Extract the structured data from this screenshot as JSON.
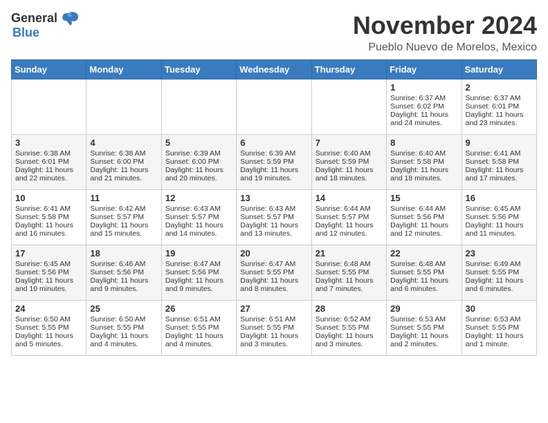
{
  "header": {
    "logo_general": "General",
    "logo_blue": "Blue",
    "month": "November 2024",
    "location": "Pueblo Nuevo de Morelos, Mexico"
  },
  "days_of_week": [
    "Sunday",
    "Monday",
    "Tuesday",
    "Wednesday",
    "Thursday",
    "Friday",
    "Saturday"
  ],
  "weeks": [
    [
      {
        "day": "",
        "sunrise": "",
        "sunset": "",
        "daylight": ""
      },
      {
        "day": "",
        "sunrise": "",
        "sunset": "",
        "daylight": ""
      },
      {
        "day": "",
        "sunrise": "",
        "sunset": "",
        "daylight": ""
      },
      {
        "day": "",
        "sunrise": "",
        "sunset": "",
        "daylight": ""
      },
      {
        "day": "",
        "sunrise": "",
        "sunset": "",
        "daylight": ""
      },
      {
        "day": "1",
        "sunrise": "Sunrise: 6:37 AM",
        "sunset": "Sunset: 6:02 PM",
        "daylight": "Daylight: 11 hours and 24 minutes."
      },
      {
        "day": "2",
        "sunrise": "Sunrise: 6:37 AM",
        "sunset": "Sunset: 6:01 PM",
        "daylight": "Daylight: 11 hours and 23 minutes."
      }
    ],
    [
      {
        "day": "3",
        "sunrise": "Sunrise: 6:38 AM",
        "sunset": "Sunset: 6:01 PM",
        "daylight": "Daylight: 11 hours and 22 minutes."
      },
      {
        "day": "4",
        "sunrise": "Sunrise: 6:38 AM",
        "sunset": "Sunset: 6:00 PM",
        "daylight": "Daylight: 11 hours and 21 minutes."
      },
      {
        "day": "5",
        "sunrise": "Sunrise: 6:39 AM",
        "sunset": "Sunset: 6:00 PM",
        "daylight": "Daylight: 11 hours and 20 minutes."
      },
      {
        "day": "6",
        "sunrise": "Sunrise: 6:39 AM",
        "sunset": "Sunset: 5:59 PM",
        "daylight": "Daylight: 11 hours and 19 minutes."
      },
      {
        "day": "7",
        "sunrise": "Sunrise: 6:40 AM",
        "sunset": "Sunset: 5:59 PM",
        "daylight": "Daylight: 11 hours and 18 minutes."
      },
      {
        "day": "8",
        "sunrise": "Sunrise: 6:40 AM",
        "sunset": "Sunset: 5:58 PM",
        "daylight": "Daylight: 11 hours and 18 minutes."
      },
      {
        "day": "9",
        "sunrise": "Sunrise: 6:41 AM",
        "sunset": "Sunset: 5:58 PM",
        "daylight": "Daylight: 11 hours and 17 minutes."
      }
    ],
    [
      {
        "day": "10",
        "sunrise": "Sunrise: 6:41 AM",
        "sunset": "Sunset: 5:58 PM",
        "daylight": "Daylight: 11 hours and 16 minutes."
      },
      {
        "day": "11",
        "sunrise": "Sunrise: 6:42 AM",
        "sunset": "Sunset: 5:57 PM",
        "daylight": "Daylight: 11 hours and 15 minutes."
      },
      {
        "day": "12",
        "sunrise": "Sunrise: 6:43 AM",
        "sunset": "Sunset: 5:57 PM",
        "daylight": "Daylight: 11 hours and 14 minutes."
      },
      {
        "day": "13",
        "sunrise": "Sunrise: 6:43 AM",
        "sunset": "Sunset: 5:57 PM",
        "daylight": "Daylight: 11 hours and 13 minutes."
      },
      {
        "day": "14",
        "sunrise": "Sunrise: 6:44 AM",
        "sunset": "Sunset: 5:57 PM",
        "daylight": "Daylight: 11 hours and 12 minutes."
      },
      {
        "day": "15",
        "sunrise": "Sunrise: 6:44 AM",
        "sunset": "Sunset: 5:56 PM",
        "daylight": "Daylight: 11 hours and 12 minutes."
      },
      {
        "day": "16",
        "sunrise": "Sunrise: 6:45 AM",
        "sunset": "Sunset: 5:56 PM",
        "daylight": "Daylight: 11 hours and 11 minutes."
      }
    ],
    [
      {
        "day": "17",
        "sunrise": "Sunrise: 6:45 AM",
        "sunset": "Sunset: 5:56 PM",
        "daylight": "Daylight: 11 hours and 10 minutes."
      },
      {
        "day": "18",
        "sunrise": "Sunrise: 6:46 AM",
        "sunset": "Sunset: 5:56 PM",
        "daylight": "Daylight: 11 hours and 9 minutes."
      },
      {
        "day": "19",
        "sunrise": "Sunrise: 6:47 AM",
        "sunset": "Sunset: 5:56 PM",
        "daylight": "Daylight: 11 hours and 9 minutes."
      },
      {
        "day": "20",
        "sunrise": "Sunrise: 6:47 AM",
        "sunset": "Sunset: 5:55 PM",
        "daylight": "Daylight: 11 hours and 8 minutes."
      },
      {
        "day": "21",
        "sunrise": "Sunrise: 6:48 AM",
        "sunset": "Sunset: 5:55 PM",
        "daylight": "Daylight: 11 hours and 7 minutes."
      },
      {
        "day": "22",
        "sunrise": "Sunrise: 6:48 AM",
        "sunset": "Sunset: 5:55 PM",
        "daylight": "Daylight: 11 hours and 6 minutes."
      },
      {
        "day": "23",
        "sunrise": "Sunrise: 6:49 AM",
        "sunset": "Sunset: 5:55 PM",
        "daylight": "Daylight: 11 hours and 6 minutes."
      }
    ],
    [
      {
        "day": "24",
        "sunrise": "Sunrise: 6:50 AM",
        "sunset": "Sunset: 5:55 PM",
        "daylight": "Daylight: 11 hours and 5 minutes."
      },
      {
        "day": "25",
        "sunrise": "Sunrise: 6:50 AM",
        "sunset": "Sunset: 5:55 PM",
        "daylight": "Daylight: 11 hours and 4 minutes."
      },
      {
        "day": "26",
        "sunrise": "Sunrise: 6:51 AM",
        "sunset": "Sunset: 5:55 PM",
        "daylight": "Daylight: 11 hours and 4 minutes."
      },
      {
        "day": "27",
        "sunrise": "Sunrise: 6:51 AM",
        "sunset": "Sunset: 5:55 PM",
        "daylight": "Daylight: 11 hours and 3 minutes."
      },
      {
        "day": "28",
        "sunrise": "Sunrise: 6:52 AM",
        "sunset": "Sunset: 5:55 PM",
        "daylight": "Daylight: 11 hours and 3 minutes."
      },
      {
        "day": "29",
        "sunrise": "Sunrise: 6:53 AM",
        "sunset": "Sunset: 5:55 PM",
        "daylight": "Daylight: 11 hours and 2 minutes."
      },
      {
        "day": "30",
        "sunrise": "Sunrise: 6:53 AM",
        "sunset": "Sunset: 5:55 PM",
        "daylight": "Daylight: 11 hours and 1 minute."
      }
    ]
  ]
}
